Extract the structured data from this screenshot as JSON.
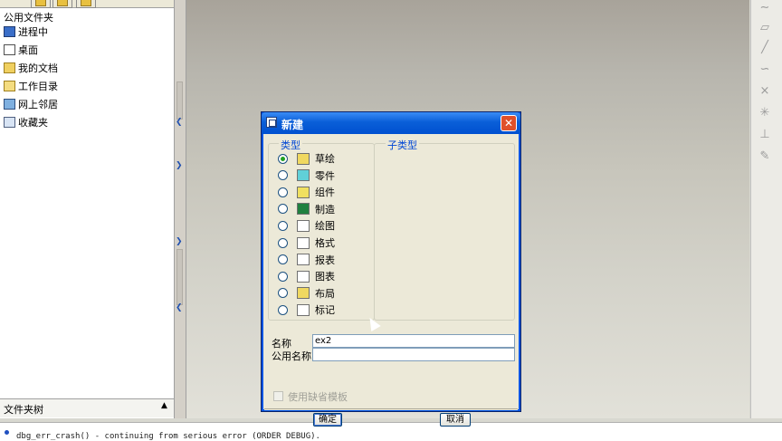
{
  "navigator": {
    "title": "公用文件夹",
    "items": [
      {
        "label": "进程中",
        "icon": "monitor-icon"
      },
      {
        "label": "桌面",
        "icon": "desktop-icon"
      },
      {
        "label": "我的文档",
        "icon": "documents-folder-icon"
      },
      {
        "label": "工作目录",
        "icon": "working-dir-folder-icon"
      },
      {
        "label": "网上邻居",
        "icon": "network-icon"
      },
      {
        "label": "收藏夹",
        "icon": "favorites-icon"
      }
    ],
    "footer_label": "文件夹树",
    "footer_arrow": "▲"
  },
  "dialog": {
    "title": "新建",
    "close_label": "✕",
    "type_group_label": "类型",
    "subtype_group_label": "子类型",
    "types": [
      {
        "label": "草绘",
        "selected": true,
        "icon": "sketch-icon"
      },
      {
        "label": "零件",
        "selected": false,
        "icon": "part-icon"
      },
      {
        "label": "组件",
        "selected": false,
        "icon": "assembly-icon"
      },
      {
        "label": "制造",
        "selected": false,
        "icon": "manufacturing-icon"
      },
      {
        "label": "绘图",
        "selected": false,
        "icon": "drawing-icon"
      },
      {
        "label": "格式",
        "selected": false,
        "icon": "format-icon"
      },
      {
        "label": "报表",
        "selected": false,
        "icon": "report-icon"
      },
      {
        "label": "图表",
        "selected": false,
        "icon": "diagram-icon"
      },
      {
        "label": "布局",
        "selected": false,
        "icon": "layout-icon"
      },
      {
        "label": "标记",
        "selected": false,
        "icon": "markup-icon"
      }
    ],
    "name_label": "名称",
    "name_value": "ex2",
    "common_name_label": "公用名称",
    "common_name_value": "",
    "use_default_template_label": "使用缺省模板",
    "ok_label": "确定",
    "cancel_label": "取消"
  },
  "message_area": {
    "text": "dbg_err_crash() - continuing from serious error (ORDER DEBUG)."
  },
  "colors": {
    "titlebar": "#0a5fd8",
    "group_label": "#0046d5",
    "radio_checked": "#21a121"
  }
}
